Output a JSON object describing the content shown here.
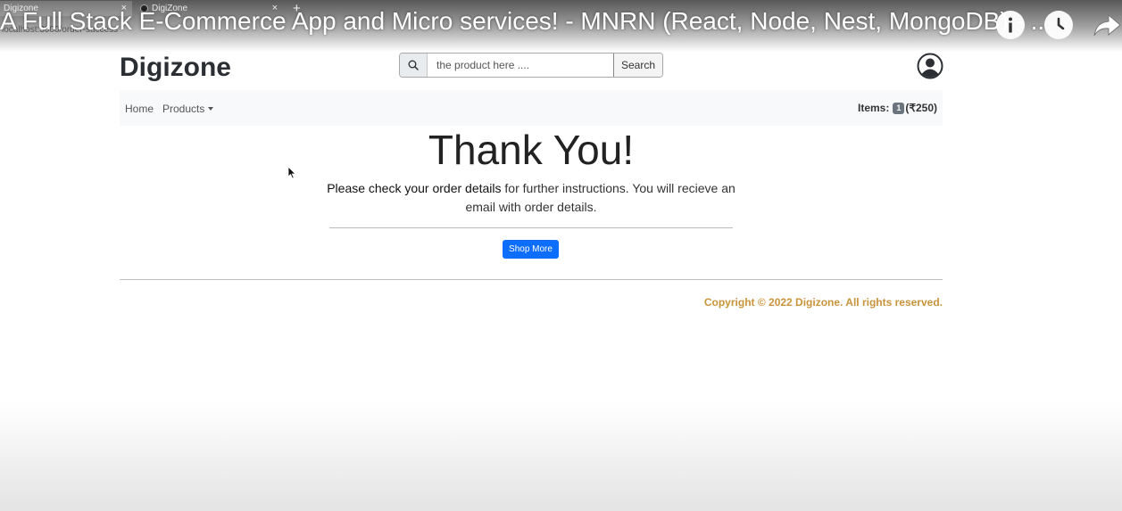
{
  "browser": {
    "tabs": [
      {
        "label": "Digizone",
        "active": true
      },
      {
        "label": "DigiZone",
        "active": false
      }
    ],
    "url_partial": "localhost:3000/order-success"
  },
  "video_overlay": {
    "title": "A Full Stack E-Commerce App and Micro services! - MNRN (React, Node, Nest, MongoDB) - ...",
    "info_icon": "info-icon",
    "watch_later_icon": "clock-icon",
    "share_icon": "share-icon"
  },
  "header": {
    "brand": "Digizone",
    "search": {
      "placeholder": "the product here ....",
      "button_label": "Search"
    },
    "avatar_icon": "user-circle-icon"
  },
  "navbar": {
    "home_label": "Home",
    "products_label": "Products",
    "cart_label": "Items:",
    "cart_count": "1",
    "cart_total": "(₹250)"
  },
  "main": {
    "title": "Thank You!",
    "message_bold": "Please check your order details",
    "message_rest": " for further instructions. You will recieve an email with order details.",
    "shop_more_label": "Shop More"
  },
  "footer": {
    "copyright": "Copyright © 2022 Digizone. All rights reserved."
  },
  "colors": {
    "primary": "#0d6efd",
    "copyright": "#c8943a",
    "navbar_bg": "#f8f9fa"
  }
}
